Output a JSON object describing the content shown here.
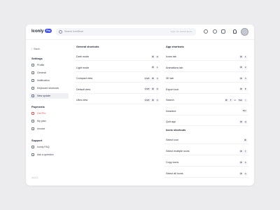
{
  "app": {
    "logo_text": "Iconly",
    "logo_badge": "Pro"
  },
  "search": {
    "placeholder": "Search IconStore",
    "hint": "Type / for search items"
  },
  "sidebar": {
    "back_label": "Back",
    "sections": [
      {
        "title": "Settings",
        "items": [
          {
            "label": "Profile",
            "icon": "user-icon"
          },
          {
            "label": "General",
            "icon": "grid-icon"
          },
          {
            "label": "Notification",
            "icon": "bell-icon"
          },
          {
            "label": "Keyboard shortcuts",
            "icon": "keyboard-icon"
          },
          {
            "label": "New update",
            "icon": "sparkle-icon"
          }
        ]
      },
      {
        "title": "Payments",
        "items": [
          {
            "label": "Get Pro",
            "icon": "crown-icon"
          },
          {
            "label": "My plan",
            "icon": "card-icon"
          },
          {
            "label": "Invoice",
            "icon": "invoice-icon"
          }
        ]
      },
      {
        "title": "Support",
        "items": [
          {
            "label": "Iconly FAQ",
            "icon": "help-icon"
          },
          {
            "label": "Ask a question",
            "icon": "chat-icon"
          }
        ]
      }
    ],
    "version": "v1.0.4"
  },
  "general_shortcuts": {
    "title": "General shortcuts",
    "rows": [
      {
        "label": "Dark mode",
        "keys": [
          "⌘",
          "D"
        ]
      },
      {
        "label": "Light mode",
        "keys": [
          "⌘",
          "L"
        ]
      },
      {
        "label": "Compact view",
        "keys": [
          "Shift",
          "⌘",
          "C"
        ]
      },
      {
        "label": "Default view",
        "keys": [
          "Shift",
          "⌘",
          "D"
        ]
      },
      {
        "label": "Ultra view",
        "keys": [
          "Shift",
          "⌘",
          "U"
        ]
      }
    ]
  },
  "app_shortcuts": {
    "title": "App shortcuts",
    "rows": [
      {
        "label": "Icons tab",
        "keys": [
          "⌘",
          "1"
        ]
      },
      {
        "label": "Animations tab",
        "keys": [
          "⌘",
          "2"
        ]
      },
      {
        "label": "3D tab",
        "keys": [
          "⌘",
          "3"
        ]
      },
      {
        "label": "Export icon",
        "keys": [
          "⌘",
          "E"
        ]
      },
      {
        "label": "Search",
        "keys": [
          "⌘",
          "F",
          "or",
          "Tab",
          "/"
        ]
      },
      {
        "label": "Deselect",
        "keys": [
          "Esc"
        ]
      },
      {
        "label": "Quit app",
        "keys": [
          "⌘",
          "Q"
        ]
      }
    ]
  },
  "icons_shortcuts": {
    "title": "Icons shortcuts",
    "rows": [
      {
        "label": "Select icon",
        "keys": [
          "⌘"
        ]
      },
      {
        "label": "Select multiple icons",
        "keys": [
          "⌘",
          "⇧"
        ]
      },
      {
        "label": "Copy icons",
        "keys": [
          "⌘",
          "C"
        ]
      },
      {
        "label": "Select all icons",
        "keys": [
          "⌘",
          "A"
        ]
      }
    ]
  },
  "colors": {
    "accent": "#4654d8",
    "danger": "#e25555"
  }
}
